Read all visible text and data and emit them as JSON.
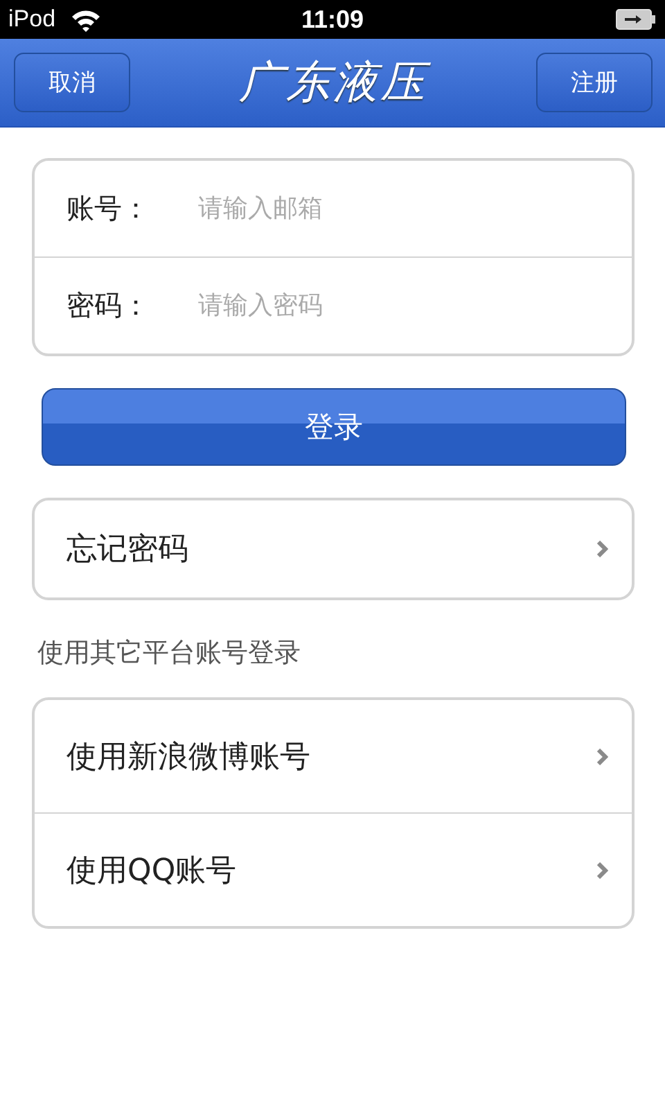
{
  "status_bar": {
    "device": "iPod",
    "time": "11:09"
  },
  "nav_bar": {
    "left_button": "取消",
    "title": "广东液压",
    "right_button": "注册"
  },
  "login_form": {
    "fields": [
      {
        "label": "账号：",
        "placeholder": "请输入邮箱"
      },
      {
        "label": "密码：",
        "placeholder": "请输入密码"
      }
    ]
  },
  "login_button": "登录",
  "forgot_password": "忘记密码",
  "section_label": "使用其它平台账号登录",
  "third_party": [
    "使用新浪微博账号",
    "使用QQ账号"
  ]
}
